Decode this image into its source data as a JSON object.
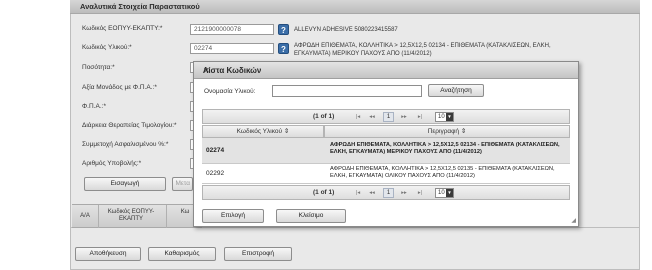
{
  "panel": {
    "title": "Αναλυτικά Στοιχεία Παραστατικού",
    "fields": [
      {
        "label": "Κωδικός ΕΟΠΥΥ-ΕΚΑΠΤΥ:*",
        "value": "2121900000078"
      },
      {
        "label": "Κωδικός Υλικού:*",
        "value": "02274"
      },
      {
        "label": "Ποσότητα:*"
      },
      {
        "label": "Αξία Μονάδος με Φ.Π.Α.:*"
      },
      {
        "label": "Φ.Π.Α.:*"
      },
      {
        "label": "Διάρκεια Θεραπείας Τιμολογίου:*"
      },
      {
        "label": "Συμμετοχή Ασφαλισμένου %:*"
      },
      {
        "label": "Αριθμός Υποβολής:*"
      }
    ],
    "product_line1": "ALLEVYN ADHESIVE 5080223415587",
    "product_desc": [
      "ΑΦΡΩΔΗ ΕΠΙΘΕΜΑΤΑ, ΚΟΛΛΗΤΙΚΑ > 12,5Χ12,5 02134 - ΕΠΙΘΕΜΑΤΑ (ΚΑΤΑΚΛΙΣΕΩΝ, ΕΛΚΗ,",
      "ΕΓΚΑΥΜΑΤΑ) ΜΕΡΙΚΟΥ ΠΑΧΟΥΣ ΑΠΟ (11/4/2012)"
    ],
    "insert_button": "Εισαγωγή",
    "partial_button": "Μετα",
    "grid_headers": [
      "Α/Α",
      "Κωδικός ΕΟΠΥΥ-ΕΚΑΠΤΥ",
      "Κω"
    ]
  },
  "footer": {
    "save": "Αποθήκευση",
    "clear": "Καθαρισμός",
    "back": "Επιστροφή"
  },
  "modal": {
    "title": "Λίστα Κωδικών",
    "search_label": "Ονομασία Υλικού:",
    "search_button": "Αναζήτηση",
    "pager": {
      "info": "(1 of 1)",
      "page": "1",
      "page_size": "10"
    },
    "columns": [
      "Κωδικός Υλικού",
      "Περιγραφή"
    ],
    "rows": [
      {
        "code": "02274",
        "desc": "ΑΦΡΩΔΗ ΕΠΙΘΕΜΑΤΑ, ΚΟΛΛΗΤΙΚΑ > 12,5Χ12,5 02134 - ΕΠΙΘΕΜΑΤΑ (ΚΑΤΑΚΛΙΣΕΩΝ, ΕΛΚΗ, ΕΓΚΑΥΜΑΤΑ) ΜΕΡΙΚΟΥ ΠΑΧΟΥΣ ΑΠΟ (11/4/2012)",
        "selected": true
      },
      {
        "code": "02292",
        "desc": "ΑΦΡΩΔΗ ΕΠΙΘΕΜΑΤΑ, ΚΟΛΛΗΤΙΚΑ > 12,5Χ12,5 02135 - ΕΠΙΘΕΜΑΤΑ (ΚΑΤΑΚΛΙΣΕΩΝ, ΕΛΚΗ, ΕΓΚΑΥΜΑΤΑ) ΟΛΙΚΟΥ ΠΑΧΟΥΣ ΑΠΟ (11/4/2012)",
        "selected": false
      }
    ],
    "select_button": "Επιλογή",
    "close_button": "Κλείσιμο"
  },
  "icons": {
    "help": "help-icon",
    "sort": "sort-icon",
    "close": "close-icon",
    "first": "first-page-icon",
    "prev": "prev-page-icon",
    "next": "next-page-icon",
    "last": "last-page-icon",
    "dropdown": "chevron-down-icon",
    "resize": "resize-grip-icon"
  },
  "colors": {
    "help_button": "#3b6ea8",
    "selected_row": "#e3e3e3"
  }
}
